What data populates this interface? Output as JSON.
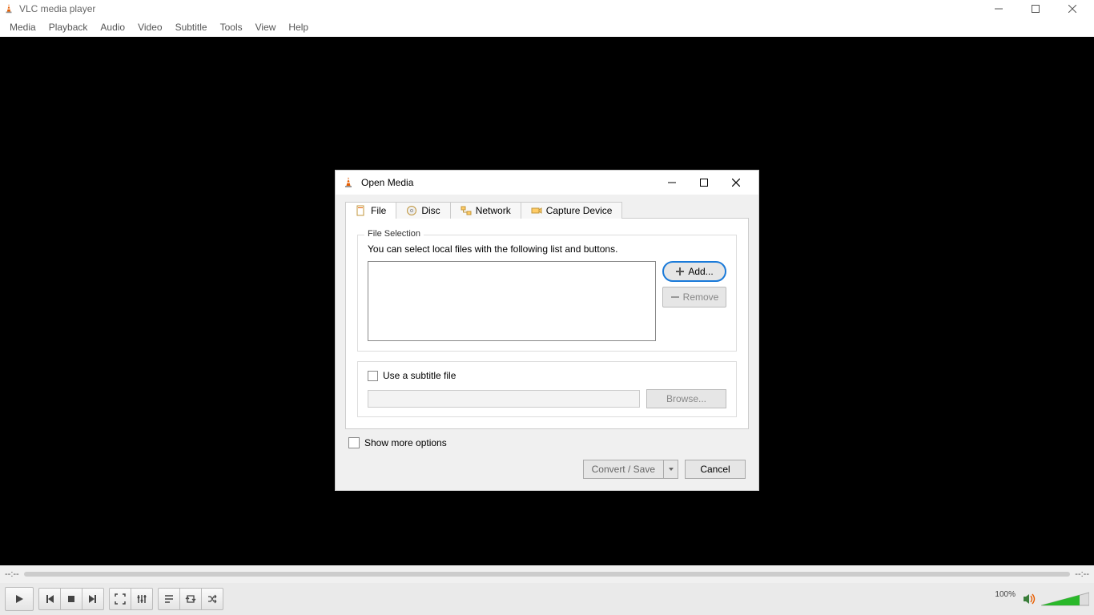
{
  "window": {
    "title": "VLC media player"
  },
  "menu": {
    "items": [
      "Media",
      "Playback",
      "Audio",
      "Video",
      "Subtitle",
      "Tools",
      "View",
      "Help"
    ]
  },
  "dialog": {
    "title": "Open Media",
    "tabs": [
      {
        "icon": "file-icon",
        "label": "File"
      },
      {
        "icon": "disc-icon",
        "label": "Disc"
      },
      {
        "icon": "network-icon",
        "label": "Network"
      },
      {
        "icon": "capture-icon",
        "label": "Capture Device"
      }
    ],
    "file_selection": {
      "legend": "File Selection",
      "description": "You can select local files with the following list and buttons.",
      "add_label": "Add...",
      "remove_label": "Remove"
    },
    "subtitle": {
      "checkbox_label": "Use a subtitle file",
      "browse_label": "Browse..."
    },
    "show_more_label": "Show more options",
    "convert_label": "Convert / Save",
    "cancel_label": "Cancel"
  },
  "player": {
    "time_left": "--:--",
    "time_right": "--:--",
    "volume_label": "100%"
  }
}
